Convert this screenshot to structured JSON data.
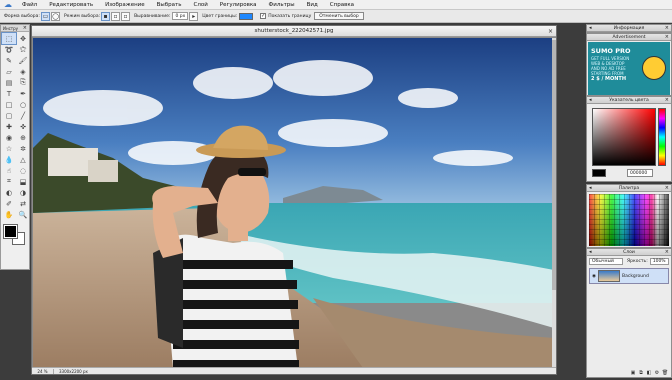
{
  "menubar": {
    "items": [
      "Файл",
      "Редактировать",
      "Изображение",
      "Выбрать",
      "Слой",
      "Регулировка",
      "Фильтры",
      "Вид",
      "Справка"
    ]
  },
  "optionsbar": {
    "shape_label": "Форма выбора:",
    "mode_label": "Режим выбора:",
    "feather_label": "Выравнивание:",
    "feather_value": "0 px",
    "border_color_label": "Цвет границы:",
    "show_border_label": "Показать границу",
    "cancel_selection_label": "Отменить выбор"
  },
  "toolpanel": {
    "title": "Инстру"
  },
  "canvas": {
    "filename": "shutterstock_222042571.jpg",
    "zoom": "24 %",
    "dimensions": "3300x2200 px"
  },
  "info_panel": {
    "title": "Информация"
  },
  "ad_panel": {
    "title": "Advertisement",
    "brand": "SUMO PRO",
    "line1": "GET FULL VERSION",
    "line2": "WEB & DESKTOP",
    "line3": "AND NO AD FREE",
    "line4": "STARTING FROM",
    "price": "2 $ / MONTH"
  },
  "color_panel": {
    "title": "Указатель цвета",
    "hex": "000000"
  },
  "palette_panel": {
    "title": "Палитра"
  },
  "layers_panel": {
    "title": "Слои",
    "blend_mode": "Обычный",
    "opacity_label": "Яркость:",
    "opacity_value": "100%",
    "layer_name": "Background"
  },
  "colors": {
    "accent": "#1e88ff",
    "ad_bg": "#1f8c9a",
    "menubar_bg": "#f0f0f0"
  }
}
